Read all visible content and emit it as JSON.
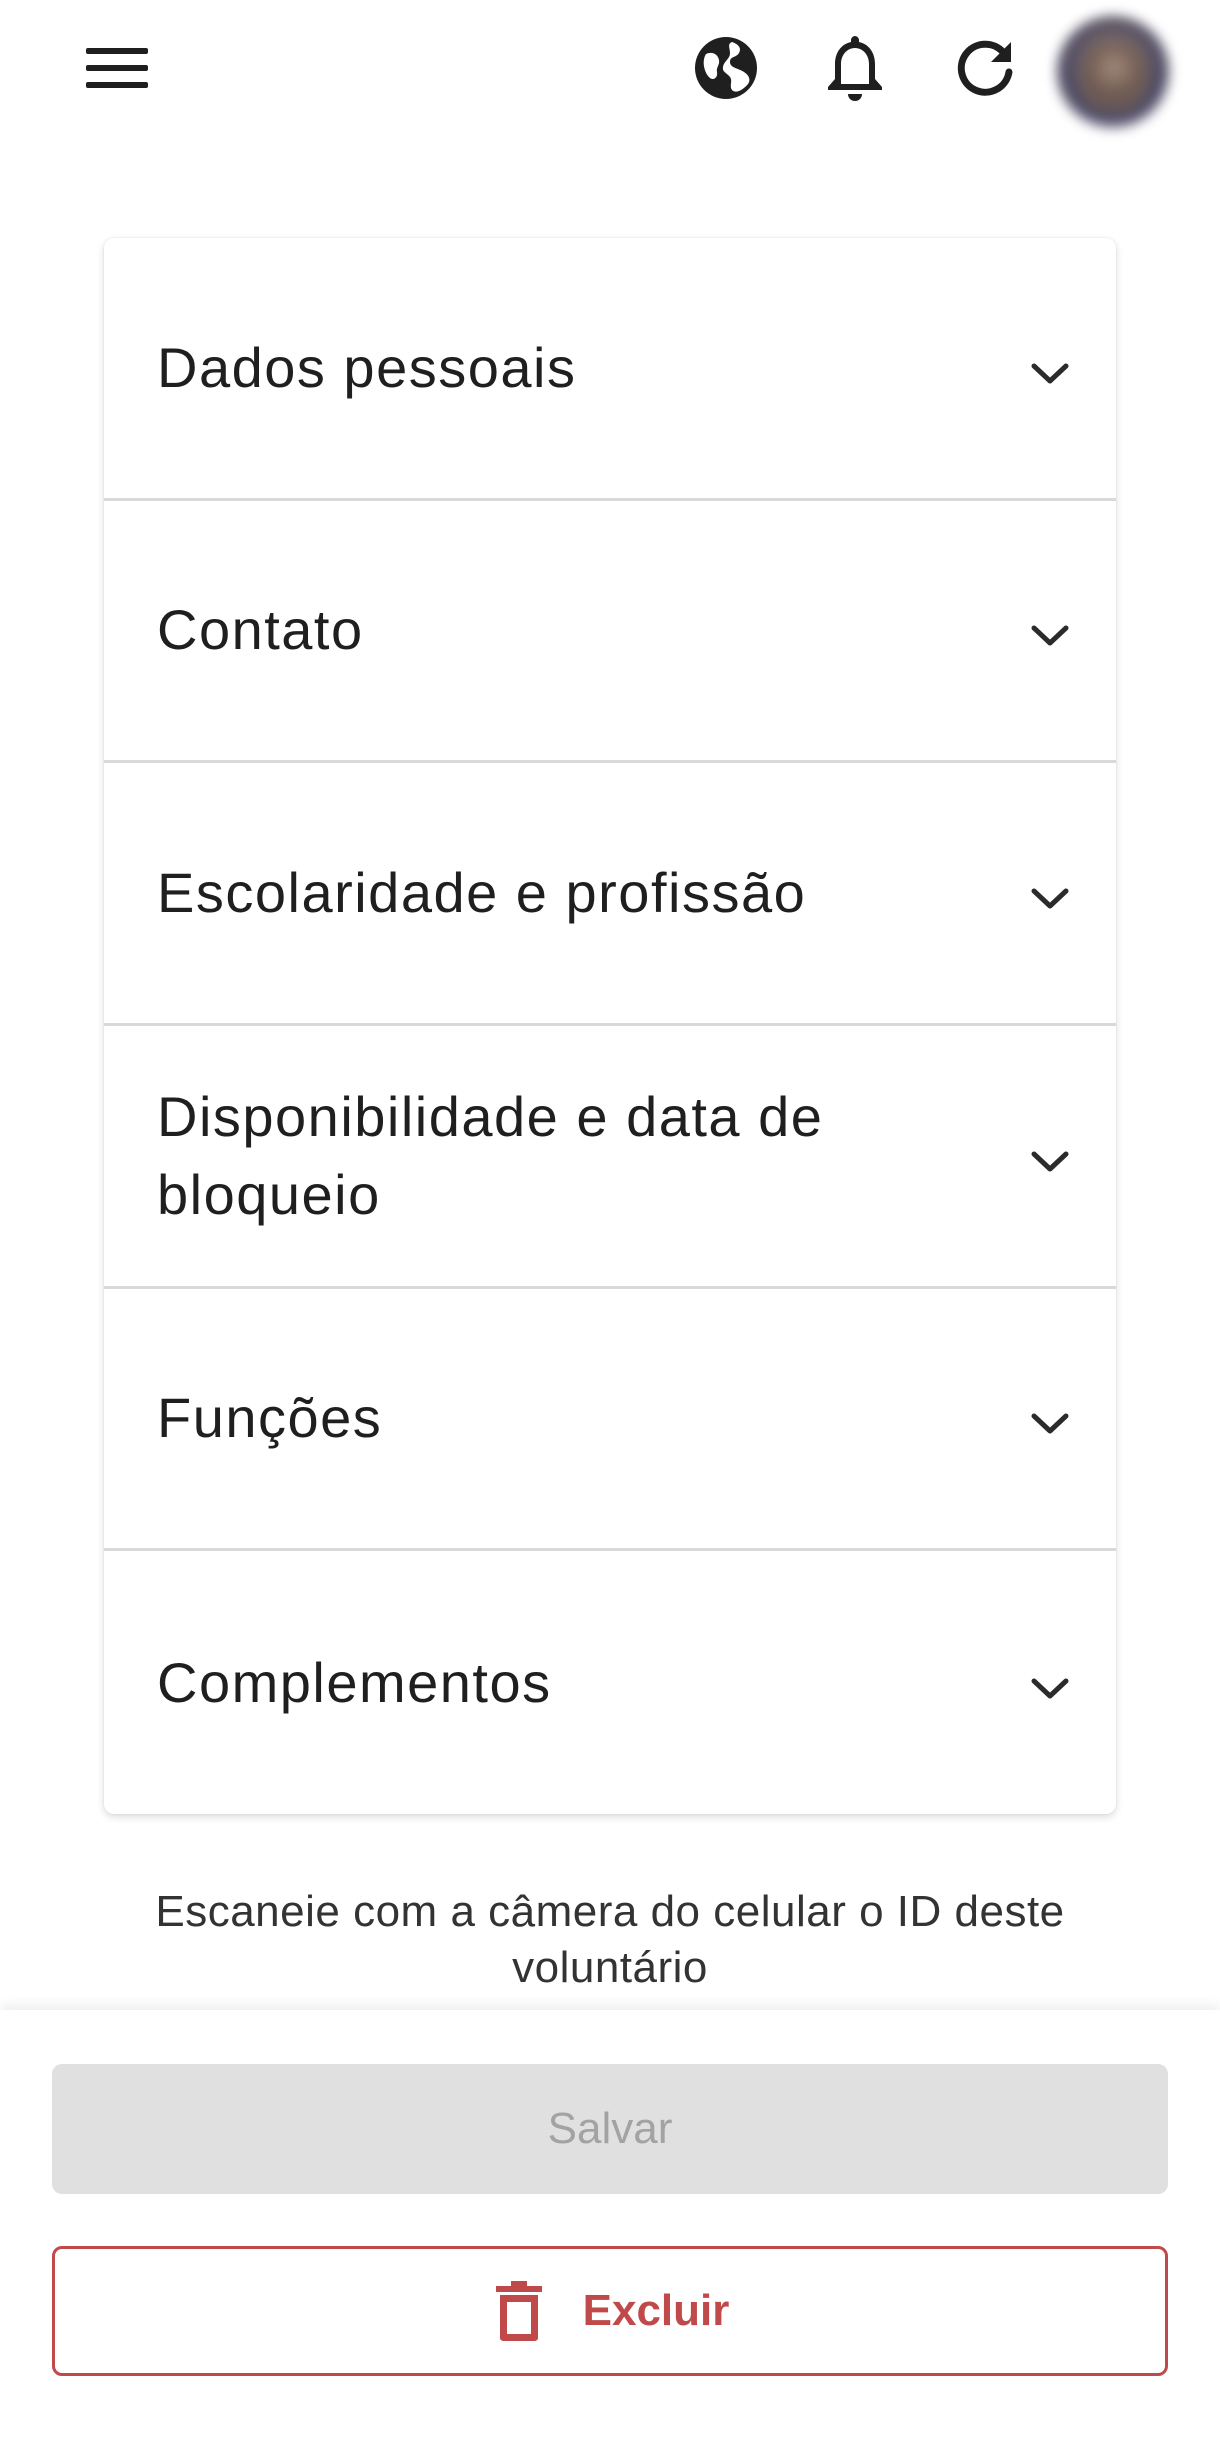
{
  "topbar": {
    "icons": [
      "menu-icon",
      "globe-icon",
      "bell-icon",
      "refresh-icon"
    ],
    "avatar": "user-avatar"
  },
  "accordion": {
    "items": [
      {
        "label": "Dados pessoais"
      },
      {
        "label": "Contato"
      },
      {
        "label": "Escolaridade e profissão"
      },
      {
        "label": "Disponibilidade e data de bloqueio"
      },
      {
        "label": "Funções"
      },
      {
        "label": "Complementos"
      }
    ]
  },
  "scan_hint": "Escaneie com a câmera do celular o ID deste voluntário",
  "actions": {
    "save_label": "Salvar",
    "delete_label": "Excluir"
  },
  "colors": {
    "danger": "#c0494a",
    "disabled_bg": "#e0e0e0",
    "disabled_text": "#a3a3a3",
    "icon": "#1f1f1f"
  }
}
